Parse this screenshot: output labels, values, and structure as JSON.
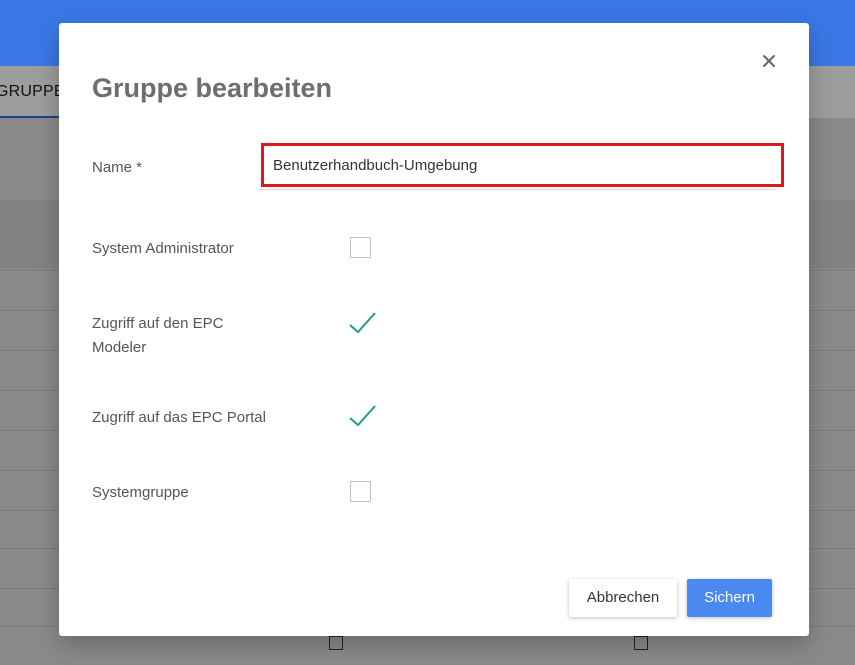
{
  "background": {
    "tab_label": "GRUPPEN",
    "header_color": "#3a78e6"
  },
  "dialog": {
    "title": "Gruppe bearbeiten",
    "close_icon": "close-icon",
    "fields": {
      "name": {
        "label": "Name *",
        "value": "Benutzerhandbuch-Umgebung",
        "highlight_color": "#e0161e"
      },
      "system_admin": {
        "label": "System Administrator",
        "checked": false
      },
      "epc_modeler": {
        "label_line1": "Zugriff auf den EPC",
        "label_line2": "Modeler",
        "checked": true
      },
      "epc_portal": {
        "label": "Zugriff auf das EPC Portal",
        "checked": true
      },
      "system_group": {
        "label": "Systemgruppe",
        "checked": false
      }
    },
    "buttons": {
      "cancel": "Abbrechen",
      "save": "Sichern"
    },
    "colors": {
      "check": "#1a9e8c",
      "primary": "#4a89f0"
    }
  }
}
